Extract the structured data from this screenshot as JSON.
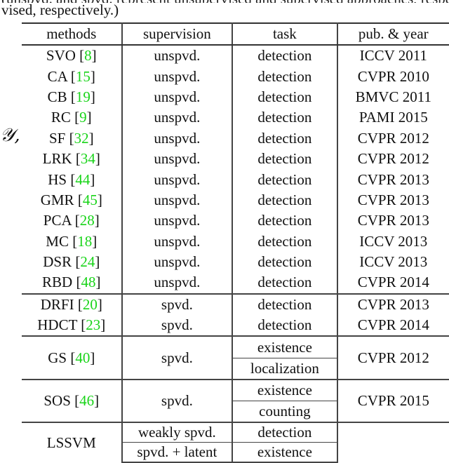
{
  "caption": {
    "cut_previous_line": "(unspvd. and spvd. represent unsupervised and supervised approaches, respectively. weakly spvd. and super-",
    "text": "vised, respectively.)",
    "side_symbol": "𝒴,"
  },
  "table": {
    "headers": [
      "methods",
      "supervision",
      "task",
      "pub. & year"
    ],
    "unsupervised_rows": [
      {
        "method": "SVO",
        "ref": "8",
        "supervision": "unspvd.",
        "task": "detection",
        "venue": "ICCV 2011"
      },
      {
        "method": "CA",
        "ref": "15",
        "supervision": "unspvd.",
        "task": "detection",
        "venue": "CVPR 2010"
      },
      {
        "method": "CB",
        "ref": "19",
        "supervision": "unspvd.",
        "task": "detection",
        "venue": "BMVC 2011"
      },
      {
        "method": "RC",
        "ref": "9",
        "supervision": "unspvd.",
        "task": "detection",
        "venue": "PAMI 2015"
      },
      {
        "method": "SF",
        "ref": "32",
        "supervision": "unspvd.",
        "task": "detection",
        "venue": "CVPR 2012"
      },
      {
        "method": "LRK",
        "ref": "34",
        "supervision": "unspvd.",
        "task": "detection",
        "venue": "CVPR 2012"
      },
      {
        "method": "HS",
        "ref": "44",
        "supervision": "unspvd.",
        "task": "detection",
        "venue": "CVPR 2013"
      },
      {
        "method": "GMR",
        "ref": "45",
        "supervision": "unspvd.",
        "task": "detection",
        "venue": "CVPR 2013"
      },
      {
        "method": "PCA",
        "ref": "28",
        "supervision": "unspvd.",
        "task": "detection",
        "venue": "CVPR 2013"
      },
      {
        "method": "MC",
        "ref": "18",
        "supervision": "unspvd.",
        "task": "detection",
        "venue": "ICCV 2013"
      },
      {
        "method": "DSR",
        "ref": "24",
        "supervision": "unspvd.",
        "task": "detection",
        "venue": "ICCV 2013"
      },
      {
        "method": "RBD",
        "ref": "48",
        "supervision": "unspvd.",
        "task": "detection",
        "venue": "CVPR 2014"
      }
    ],
    "supervised_rows": [
      {
        "method": "DRFI",
        "ref": "20",
        "supervision": "spvd.",
        "task": "detection",
        "venue": "CVPR 2013"
      },
      {
        "method": "HDCT",
        "ref": "23",
        "supervision": "spvd.",
        "task": "detection",
        "venue": "CVPR 2014"
      }
    ],
    "gs": {
      "method": "GS",
      "ref": "40",
      "supervision": "spvd.",
      "tasks": [
        "existence",
        "localization"
      ],
      "venue": "CVPR 2012"
    },
    "sos": {
      "method": "SOS",
      "ref": "46",
      "supervision": "spvd.",
      "tasks": [
        "existence",
        "counting"
      ],
      "venue": "CVPR 2015"
    },
    "lssvm": {
      "method": "LSSVM",
      "rows": [
        {
          "supervision": "weakly spvd.",
          "task": "detection"
        },
        {
          "supervision": "spvd. + latent",
          "task": "existence"
        }
      ],
      "venue": ""
    },
    "colors": {
      "reference_link": "#19d419",
      "rule": "#333333"
    }
  }
}
